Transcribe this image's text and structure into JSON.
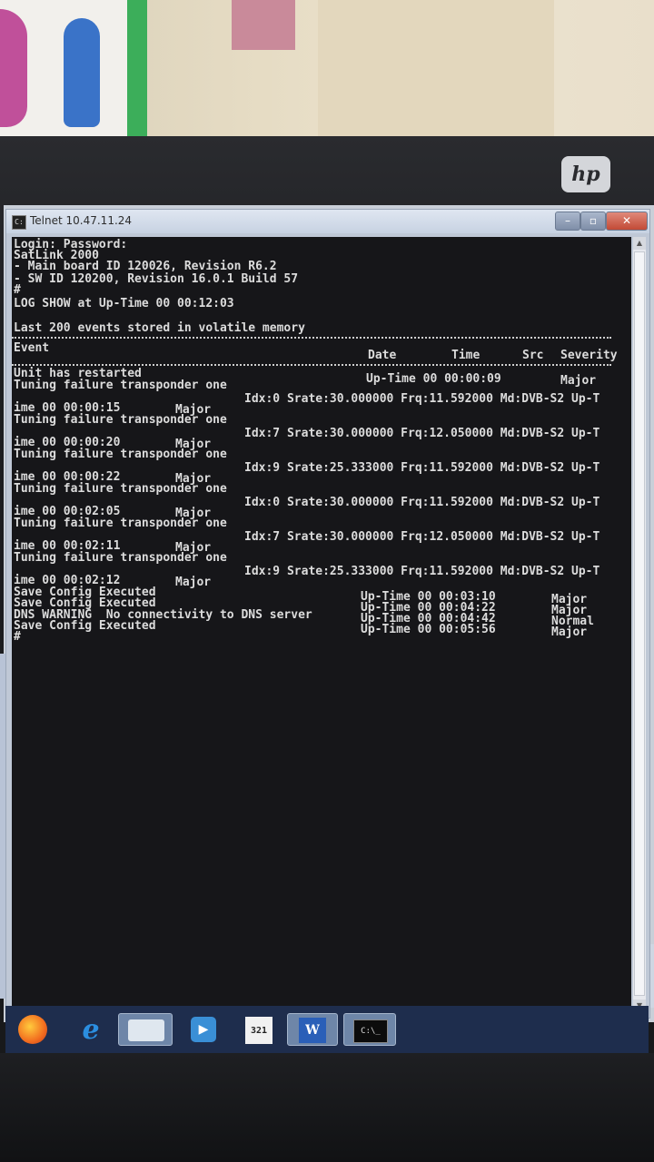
{
  "window": {
    "title": "Telnet 10.47.11.24",
    "controls": {
      "minimize": "–",
      "maximize": "▫",
      "close": "✕"
    }
  },
  "console": {
    "header_lines": [
      "Login: Password:",
      "SatLink 2000",
      "- Main board ID 120026, Revision R6.2",
      "- SW ID 120200, Revision 16.0.1 Build 57",
      "#",
      "LOG SHOW at Up-Time 00 00:12:03"
    ],
    "stored_line": "Last 200 events stored in volatile memory",
    "columns": {
      "event": "Event",
      "date": "Date",
      "time": "Time",
      "src": "Src",
      "severity": "Severity"
    },
    "restart_event": {
      "text": "Unit has restarted",
      "date": "Up-Time 00 00:00:09",
      "severity": "Major"
    },
    "tuning_events": [
      {
        "text": "Tuning failure transponder one",
        "detail": "Idx:0 Srate:30.000000 Frq:11.592000 Md:DVB-S2 Up-T",
        "tail": "ime 00 00:00:15",
        "severity": "Major"
      },
      {
        "text": "Tuning failure transponder one",
        "detail": "Idx:7 Srate:30.000000 Frq:12.050000 Md:DVB-S2 Up-T",
        "tail": "ime 00 00:00:20",
        "severity": "Major"
      },
      {
        "text": "Tuning failure transponder one",
        "detail": "Idx:9 Srate:25.333000 Frq:11.592000 Md:DVB-S2 Up-T",
        "tail": "ime 00 00:00:22",
        "severity": "Major"
      },
      {
        "text": "Tuning failure transponder one",
        "detail": "Idx:0 Srate:30.000000 Frq:11.592000 Md:DVB-S2 Up-T",
        "tail": "ime 00 00:02:05",
        "severity": "Major"
      },
      {
        "text": "Tuning failure transponder one",
        "detail": "Idx:7 Srate:30.000000 Frq:12.050000 Md:DVB-S2 Up-T",
        "tail": "ime 00 00:02:11",
        "severity": "Major"
      },
      {
        "text": "Tuning failure transponder one",
        "detail": "Idx:9 Srate:25.333000 Frq:11.592000 Md:DVB-S2 Up-T",
        "tail": "ime 00 00:02:12",
        "severity": "Major"
      }
    ],
    "final_events": [
      {
        "text": "Save Config Executed",
        "date": "Up-Time 00 00:03:10",
        "severity": "Major"
      },
      {
        "text": "Save Config Executed",
        "date": "Up-Time 00 00:04:22",
        "severity": "Major"
      },
      {
        "text": "DNS WARNING  No connectivity to DNS server",
        "date": "Up-Time 00 00:04:42",
        "severity": "Normal"
      },
      {
        "text": "Save Config Executed",
        "date": "Up-Time 00 00:05:56",
        "severity": "Major"
      }
    ],
    "prompt": "#"
  },
  "taskbar": {
    "apps": [
      {
        "name": "firefox-icon"
      },
      {
        "name": "internet-explorer-icon",
        "glyph": "e"
      },
      {
        "name": "file-explorer-icon"
      },
      {
        "name": "media-player-icon",
        "glyph": "▶"
      },
      {
        "name": "calendar-icon",
        "glyph": "321"
      },
      {
        "name": "word-icon",
        "glyph": "W"
      },
      {
        "name": "command-prompt-icon",
        "glyph": "C:\\_"
      }
    ]
  },
  "monitor": {
    "brand": "hp"
  },
  "colors": {
    "console_bg": "#161619",
    "console_text": "#dcdcdc",
    "taskbar_bg": "#1e2d4d",
    "close_button": "#c24a36"
  }
}
